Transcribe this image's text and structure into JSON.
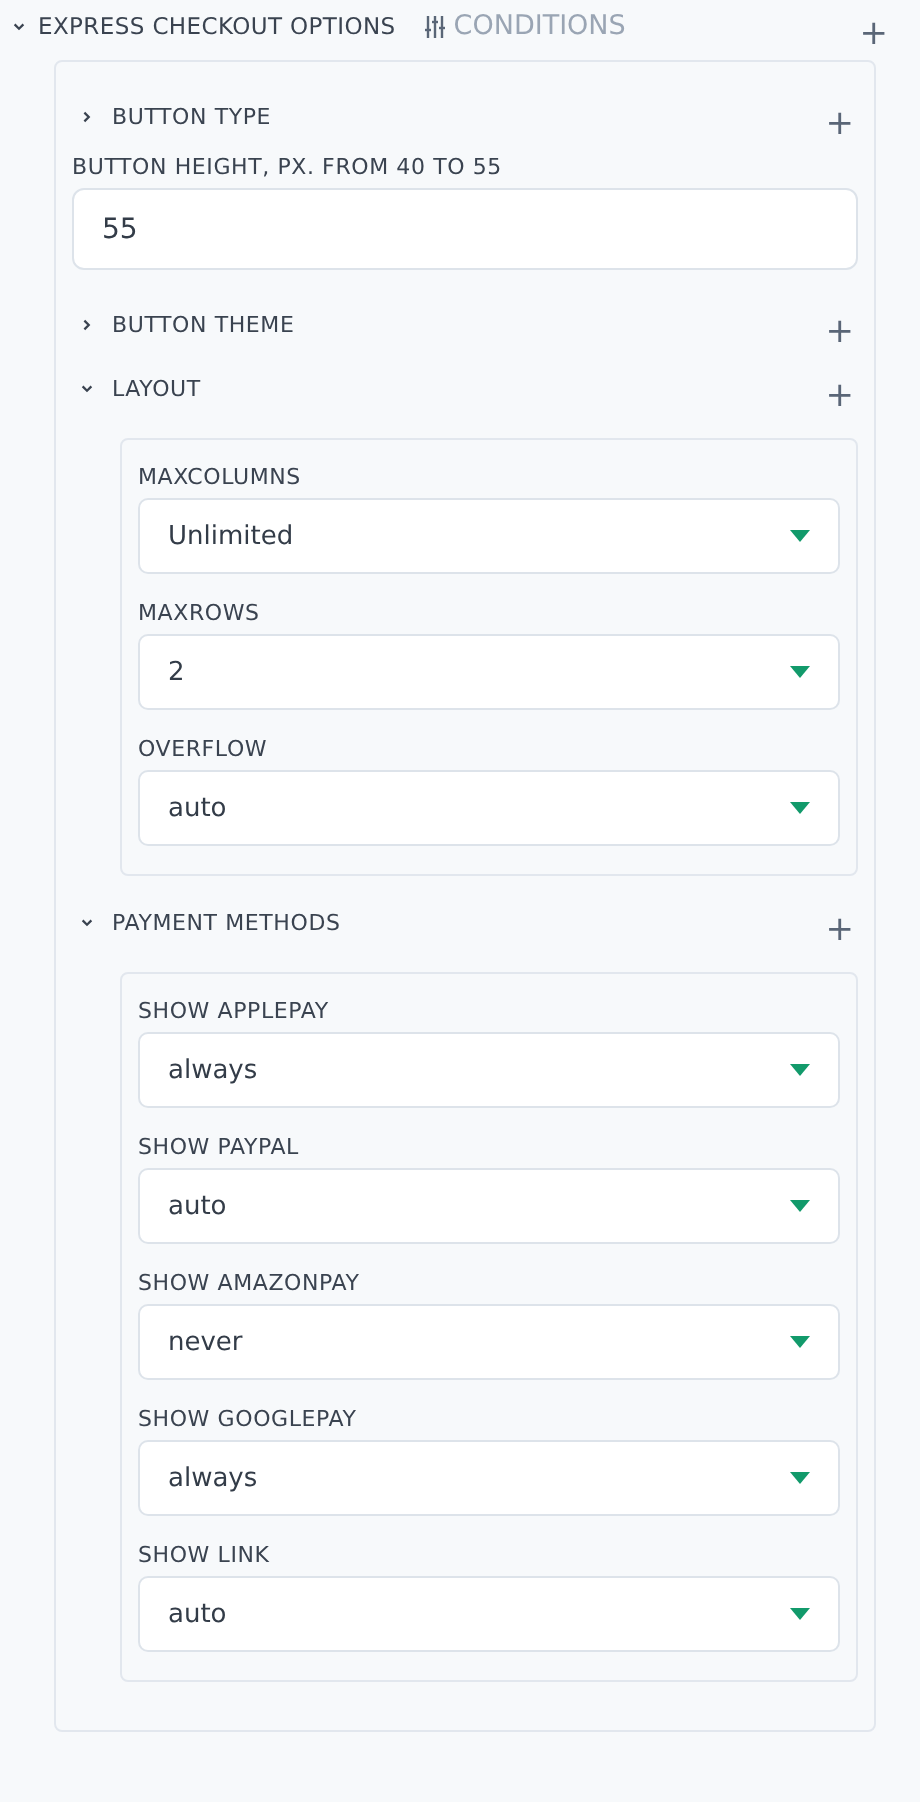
{
  "section": {
    "title": "EXPRESS CHECKOUT OPTIONS",
    "expanded": true,
    "conditions_label": "CONDITIONS",
    "add_label": "+"
  },
  "items": [
    {
      "kind": "group",
      "title": "BUTTON TYPE",
      "expanded": false,
      "add_label": "+"
    },
    {
      "kind": "input",
      "label": "BUTTON HEIGHT, PX. FROM 40 TO 55",
      "value": "55"
    },
    {
      "kind": "group",
      "title": "BUTTON THEME",
      "expanded": false,
      "add_label": "+"
    },
    {
      "kind": "group",
      "title": "LAYOUT",
      "expanded": true,
      "add_label": "+",
      "fields": [
        {
          "label": "MAXCOLUMNS",
          "value": "Unlimited"
        },
        {
          "label": "MAXROWS",
          "value": "2"
        },
        {
          "label": "OVERFLOW",
          "value": "auto"
        }
      ]
    },
    {
      "kind": "group",
      "title": "PAYMENT METHODS",
      "expanded": true,
      "add_label": "+",
      "fields": [
        {
          "label": "SHOW APPLEPAY",
          "value": "always"
        },
        {
          "label": "SHOW PAYPAL",
          "value": "auto"
        },
        {
          "label": "SHOW AMAZONPAY",
          "value": "never"
        },
        {
          "label": "SHOW GOOGLEPAY",
          "value": "always"
        },
        {
          "label": "SHOW LINK",
          "value": "auto"
        }
      ]
    }
  ]
}
